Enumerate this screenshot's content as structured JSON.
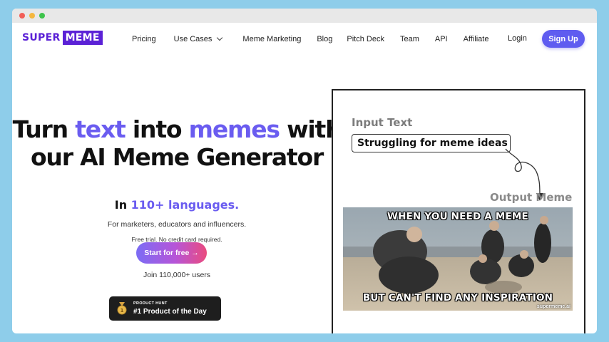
{
  "nav": {
    "logo_part1": "SUPER",
    "logo_part2": "MEME",
    "links": [
      "Pricing",
      "Use Cases",
      "Meme Marketing",
      "Blog",
      "Pitch Deck",
      "Team",
      "API",
      "Affiliate"
    ],
    "login": "Login",
    "signup": "Sign Up"
  },
  "hero": {
    "title_part1": "Turn ",
    "title_accent1": "text",
    "title_part2": " into ",
    "title_accent2": "memes",
    "title_part3": " with",
    "title_line2": "our AI Meme Generator",
    "languages_prefix": "In ",
    "languages_accent": "110+ languages.",
    "audience": "For marketers, educators and influencers.",
    "trial": "Free trial. No credit card required.",
    "cta": "Start for free →",
    "join": "Join 110,000+ users",
    "badge_small": "PRODUCT HUNT",
    "badge_big": "#1 Product of the Day"
  },
  "demo": {
    "input_label": "Input Text",
    "input_value": "Struggling for meme ideas",
    "output_label": "Output Meme",
    "meme_top": "WHEN YOU NEED A MEME",
    "meme_bottom": "BUT CAN'T FIND ANY INSPIRATION",
    "watermark": "supermeme.ai"
  },
  "colors": {
    "brand": "#5b21d6",
    "accent": "#6a5cf0",
    "signup_bg": "#5f5cf0",
    "cta_gradient": [
      "#7b6cf5",
      "#b655d8",
      "#ea4b7f"
    ],
    "page_bg": "#8ecdea"
  },
  "icons": [
    "chevron-down-icon",
    "medal-icon",
    "curved-arrow-icon"
  ]
}
